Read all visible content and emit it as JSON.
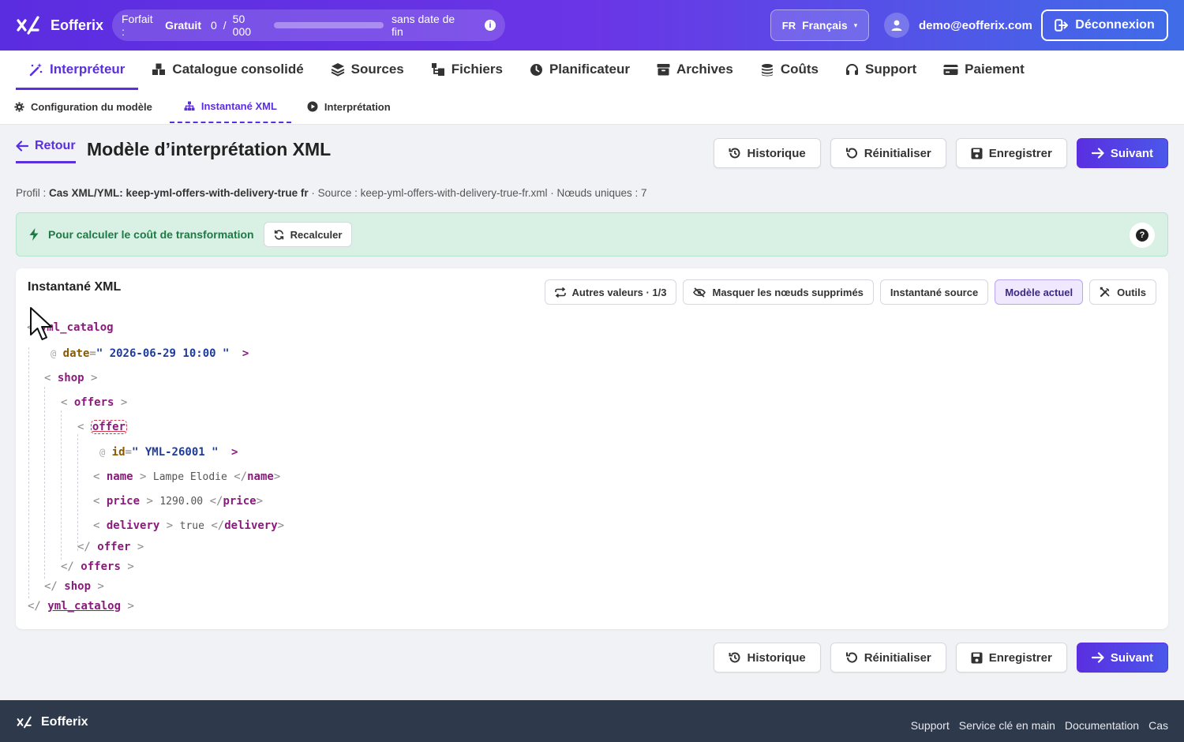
{
  "brand": {
    "name": "Eofferix"
  },
  "plan": {
    "label": "Forfait :",
    "name": "Gratuit",
    "used": "0",
    "separator": "/",
    "limit": "50 000",
    "usage_fraction": 0.0,
    "expiry": "sans date de fin",
    "info_glyph": "i"
  },
  "language": {
    "code": "FR",
    "label": "Français",
    "caret": "▾"
  },
  "user": {
    "email": "demo@eofferix.com"
  },
  "logout": {
    "label": "Déconnexion"
  },
  "main_nav": [
    {
      "label": "Interpréteur",
      "icon": "magic-wand-icon",
      "active": true
    },
    {
      "label": "Catalogue consolidé",
      "icon": "boxes-icon"
    },
    {
      "label": "Sources",
      "icon": "layers-icon"
    },
    {
      "label": "Fichiers",
      "icon": "folder-tree-icon"
    },
    {
      "label": "Planificateur",
      "icon": "clock-icon"
    },
    {
      "label": "Archives",
      "icon": "archive-icon"
    },
    {
      "label": "Coûts",
      "icon": "coins-icon"
    },
    {
      "label": "Support",
      "icon": "headset-icon"
    },
    {
      "label": "Paiement",
      "icon": "credit-card-icon"
    }
  ],
  "sub_nav": [
    {
      "label": "Configuration du modèle",
      "icon": "gear-icon"
    },
    {
      "label": "Instantané XML",
      "icon": "sitemap-icon",
      "active": true
    },
    {
      "label": "Interprétation",
      "icon": "play-circle-icon"
    }
  ],
  "page": {
    "back_label": "Retour",
    "title": "Modèle d’interprétation XML",
    "actions": {
      "history": "Historique",
      "reset": "Réinitialiser",
      "save": "Enregistrer",
      "next": "Suivant"
    },
    "meta": {
      "profile_label": "Profil :",
      "profile_value": "Cas XML/YML: keep-yml-offers-with-delivery-true fr",
      "source_label": "· Source :",
      "source_value": "keep-yml-offers-with-delivery-true-fr.xml",
      "nodes_label": "· Nœuds uniques :",
      "nodes_value": "7"
    },
    "alert": {
      "text": "Pour calculer le coût de transformation",
      "button": "Recalculer",
      "help_glyph": "?"
    }
  },
  "snapshot": {
    "title": "Instantané XML",
    "tools": {
      "other_values": "Autres valeurs · 1/3",
      "hide_deleted": "Masquer les nœuds supprimés",
      "source_snapshot": "Instantané source",
      "current_model": "Modèle actuel",
      "tools": "Outils"
    },
    "xml": {
      "root": "yml_catalog",
      "date_attr": "date",
      "date_value": "2026-06-29 10:00",
      "shop": "shop",
      "offers": "offers",
      "offer": "offer",
      "id_attr": "id",
      "id_value": "YML-26001",
      "name_tag": "name",
      "name_text": "Lampe Elodie",
      "price_tag": "price",
      "price_text": "1290.00",
      "delivery_tag": "delivery",
      "delivery_text": "true",
      "lt": "<",
      "gt": ">",
      "close": "</",
      "at": "@",
      "eq": "=",
      "quote": "\""
    }
  },
  "footer": {
    "brand": "Eofferix",
    "links": [
      "Support",
      "Service clé en main",
      "Documentation",
      "Cas"
    ]
  },
  "colors": {
    "accent": "#5a2fe0",
    "success_bg": "#d8f1e4",
    "success_text": "#1c7a46",
    "footer_bg": "#2e3a4b"
  }
}
